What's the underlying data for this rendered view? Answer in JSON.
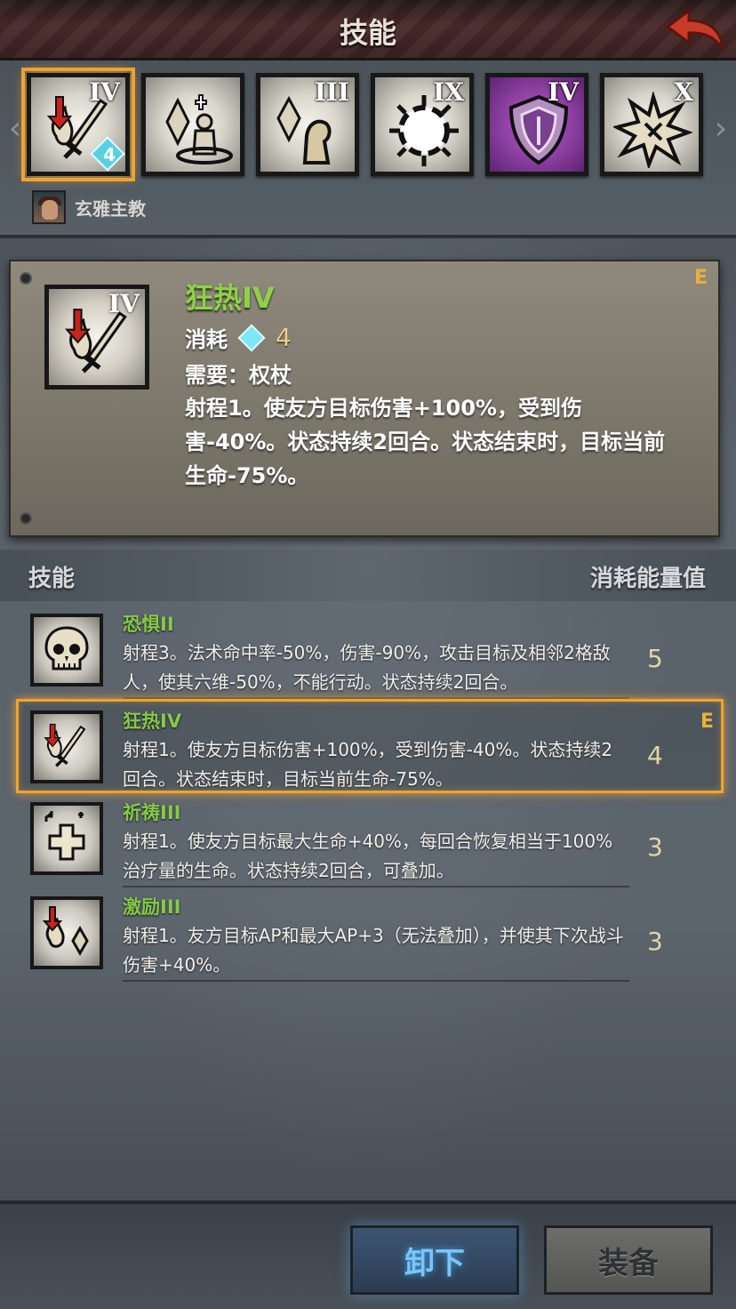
{
  "header": {
    "title": "技能"
  },
  "strip": {
    "slots": [
      {
        "icon": "fanaticism-icon",
        "rank": "IV",
        "cost": "4",
        "selected": true
      },
      {
        "icon": "crystal-pray-icon",
        "rank": ""
      },
      {
        "icon": "crystal-monk-icon",
        "rank": "III"
      },
      {
        "icon": "burst-ring-icon",
        "rank": "IX"
      },
      {
        "icon": "shield-icon",
        "rank": "IV"
      },
      {
        "icon": "explosion-icon",
        "rank": "X"
      }
    ],
    "owner_name": "玄雅主教"
  },
  "detail": {
    "tier": "E",
    "rank": "IV",
    "name": "狂热IV",
    "cost_label": "消耗",
    "cost": "4",
    "require": "需要：权杖",
    "desc": "射程1。使友方目标伤害+100%，受到伤害-40%。状态持续2回合。状态结束时，目标当前生命-75%。"
  },
  "list_header": {
    "left": "技能",
    "right": "消耗能量值"
  },
  "skills": [
    {
      "name": "恐惧II",
      "desc": "射程3。法术命中率-50%，伤害-90%，攻击目标及相邻2格敌人，使其六维-50%，不能行动。状态持续2回合。",
      "cost": "5",
      "icon": "skull-icon"
    },
    {
      "name": "狂热IV",
      "desc": "射程1。使友方目标伤害+100%，受到伤害-40%。状态持续2回合。状态结束时，目标当前生命-75%。",
      "cost": "4",
      "tier": "E",
      "icon": "fanaticism-icon",
      "selected": true
    },
    {
      "name": "祈祷III",
      "desc": "射程1。使友方目标最大生命+40%，每回合恢复相当于100%治疗量的生命。状态持续2回合，可叠加。",
      "cost": "3",
      "icon": "heal-cross-icon"
    },
    {
      "name": "激励III",
      "desc": "射程1。友方目标AP和最大AP+3（无法叠加），并使其下次战斗伤害+40%。",
      "cost": "3",
      "icon": "inspire-icon"
    }
  ],
  "buttons": {
    "unequip": "卸下",
    "equip": "装备"
  },
  "colors": {
    "accent_gold": "#f0a32c",
    "skill_green": "#8fd14a",
    "unequip_blue": "#7cc4f3"
  }
}
